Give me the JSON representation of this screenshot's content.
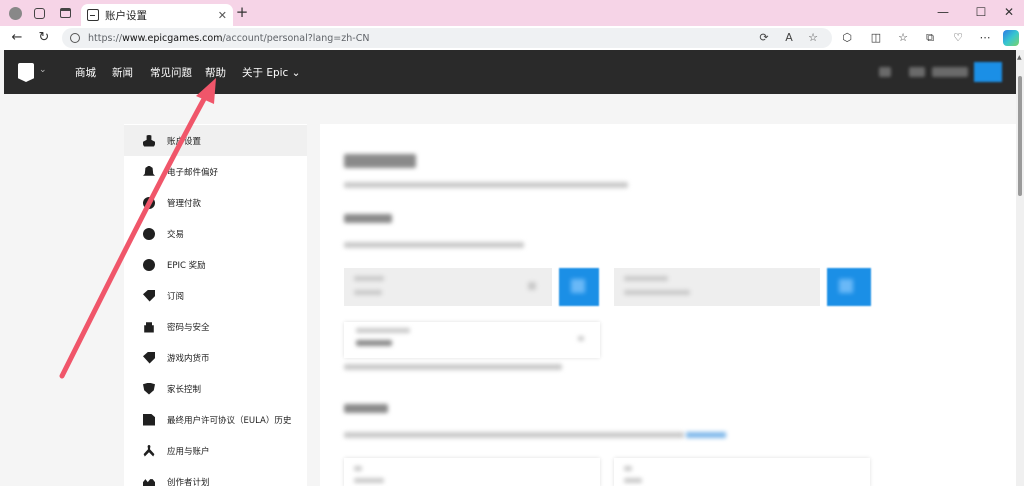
{
  "browser": {
    "tab_title": "账户设置",
    "tab_close": "✕",
    "new_tab": "+",
    "url_scheme": "https://",
    "url_host": "www.epicgames.com",
    "url_path": "/account/personal?lang=zh-CN",
    "icons": [
      "profile-icon",
      "workspaces-icon",
      "tab-actions-icon",
      "back-icon",
      "refresh-icon",
      "site-info-icon",
      "app-available-icon",
      "read-aloud-icon",
      "favorite-icon",
      "extensions-icon",
      "split-screen-icon",
      "favorites-icon",
      "collections-icon",
      "browser-essentials-icon",
      "more-icon",
      "copilot-icon"
    ]
  },
  "window_controls": {
    "minimize": "—",
    "maximize": "☐",
    "close": "✕"
  },
  "epic_nav": {
    "links": [
      "商城",
      "新闻",
      "常见问题",
      "帮助",
      "关于 Epic ⌄"
    ]
  },
  "sidebar": {
    "items": [
      {
        "label": "账户设置",
        "icon": "user-icon"
      },
      {
        "label": "电子邮件偏好",
        "icon": "bell-icon"
      },
      {
        "label": "管理付款",
        "icon": "dollar-icon"
      },
      {
        "label": "交易",
        "icon": "clock-icon"
      },
      {
        "label": "EPIC 奖励",
        "icon": "plus-icon"
      },
      {
        "label": "订阅",
        "icon": "tag-icon"
      },
      {
        "label": "密码与安全",
        "icon": "lock-icon"
      },
      {
        "label": "游戏内货币",
        "icon": "coin-tag-icon"
      },
      {
        "label": "家长控制",
        "icon": "shield-icon"
      },
      {
        "label": "最终用户许可协议（EULA）历史",
        "icon": "document-icon"
      },
      {
        "label": "应用与账户",
        "icon": "share-icon"
      },
      {
        "label": "创作者计划",
        "icon": "people-icon"
      }
    ]
  },
  "colors": {
    "nav_bg": "#2a2a2a",
    "accent_blue": "#1b8fe6",
    "annotation_red": "#f0566a",
    "titlebar_pink": "#f6d4e7"
  }
}
